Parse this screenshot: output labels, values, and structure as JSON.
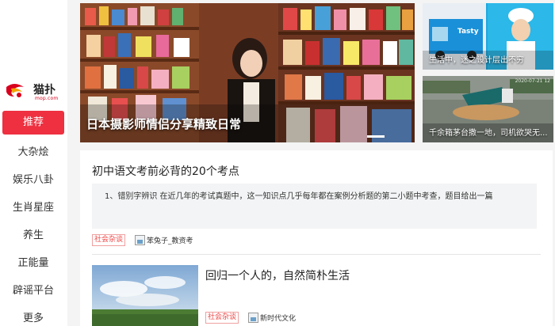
{
  "logo": {
    "mark": "猫扑",
    "url": "mop.com"
  },
  "nav": {
    "items": [
      {
        "label": "推荐",
        "active": true
      },
      {
        "label": "大杂烩"
      },
      {
        "label": "娱乐八卦"
      },
      {
        "label": "生肖星座"
      },
      {
        "label": "养生"
      },
      {
        "label": "正能量"
      },
      {
        "label": "辟谣平台"
      },
      {
        "label": "更多"
      }
    ]
  },
  "hero": {
    "caption": "日本摄影师情侣分享精致日常"
  },
  "side_cards": [
    {
      "caption": "生活中，迷之设计层出不穷"
    },
    {
      "caption": "千余箱茅台撒一地，司机欲哭无...",
      "stamp": "2020-07-21 12"
    }
  ],
  "feed": {
    "articles": [
      {
        "title": "初中语文考前必背的20个考点",
        "excerpt": "1、错别字辨识 在近几年的考试真题中，这一知识点几乎每年都在案例分析题的第二小题中考查，题目给出一篇",
        "tag": "社会杂谈",
        "source": "笨兔子_教资考"
      },
      {
        "title": "回归一个人的，自然简朴生活",
        "tag": "社会杂谈",
        "source": "新时代文化"
      }
    ]
  },
  "colors": {
    "accent": "#ee3040",
    "tag": "#ee4444",
    "brand_logo": "#d8001c"
  }
}
